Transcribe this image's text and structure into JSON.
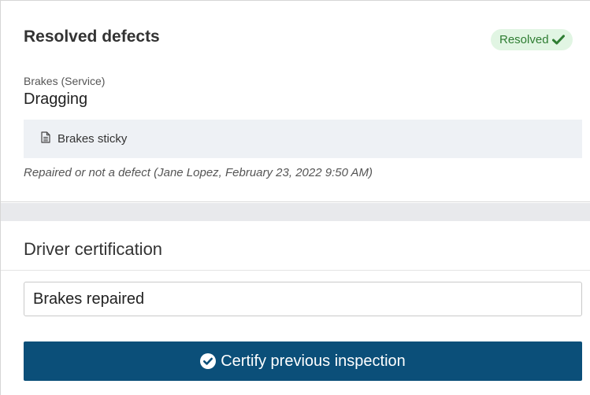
{
  "resolved_defects": {
    "title": "Resolved defects",
    "status_badge": "Resolved",
    "status_color": "#2e7d32",
    "status_bg": "#e1f5e3",
    "defect": {
      "category": "Brakes (Service)",
      "name": "Dragging",
      "note_icon": "document-icon",
      "note": "Brakes sticky",
      "resolution": "Repaired or not a defect (Jane Lopez, February 23, 2022 9:50 AM)"
    }
  },
  "driver_certification": {
    "title": "Driver certification",
    "input_value": "Brakes repaired",
    "button_icon": "check-circle-icon",
    "button_label": "Certify previous inspection",
    "button_color": "#0b4f79"
  }
}
